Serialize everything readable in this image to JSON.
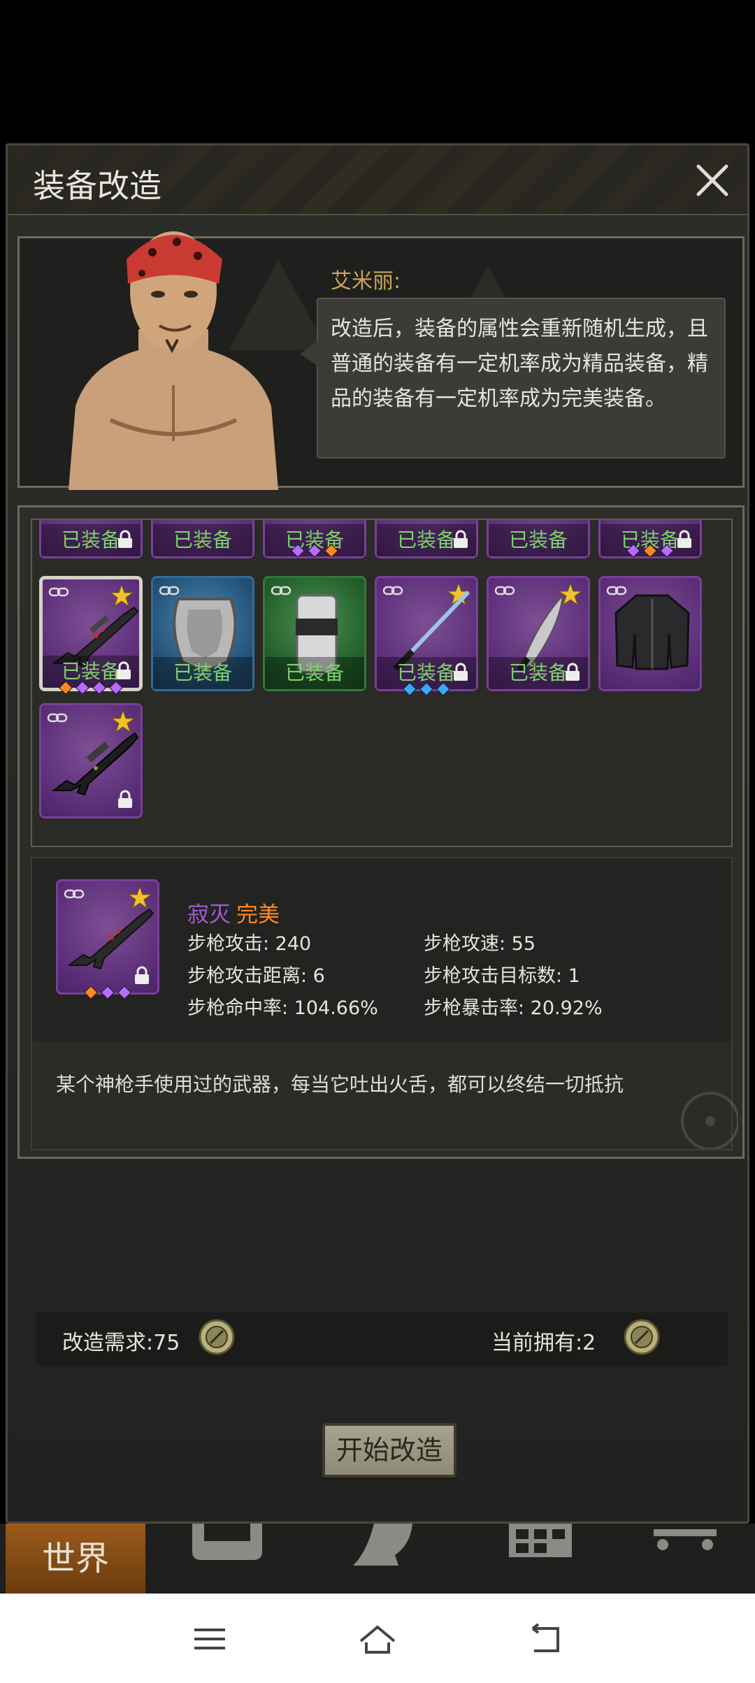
{
  "title": "装备改造",
  "npc": {
    "name": "艾米丽:",
    "speech": "改造后，装备的属性会重新随机生成，且普通的装备有一定机率成为精品装备，精品的装备有一定机率成为完美装备。"
  },
  "inventory": {
    "equipped_label": "已装备",
    "row1_count": 6,
    "items_row2": [
      {
        "icon": "assault-rifle-icon",
        "rarity": "purple",
        "equipped": true
      },
      {
        "icon": "shield-icon",
        "rarity": "blue",
        "equipped": true
      },
      {
        "icon": "arm-guard-icon",
        "rarity": "green",
        "equipped": true
      },
      {
        "icon": "katana-icon",
        "rarity": "purple",
        "equipped": true
      },
      {
        "icon": "machete-icon",
        "rarity": "purple",
        "equipped": true
      },
      {
        "icon": "jacket-icon",
        "rarity": "purple",
        "equipped": false
      }
    ],
    "items_row3": [
      {
        "icon": "sniper-rifle-icon",
        "rarity": "purple",
        "equipped": false
      }
    ]
  },
  "detail": {
    "name": "寂灭",
    "quality": "完美",
    "stats": {
      "attack": "步枪攻击: 240",
      "speed": "步枪攻速: 55",
      "range": "步枪攻击距离: 6",
      "targets": "步枪攻击目标数: 1",
      "accuracy": "步枪命中率: 104.66%",
      "crit": "步枪暴击率: 20.92%"
    },
    "description": "某个神枪手使用过的武器，每当它吐出火舌，都可以终结一切抵抗"
  },
  "requirement": {
    "need_label": "改造需求:75",
    "have_label": "当前拥有:2"
  },
  "start_button": "开始改造",
  "nav": {
    "world": "世界"
  },
  "colors": {
    "purple": "#5b2e78",
    "blue": "#234f74",
    "green": "#225c2a",
    "equipped_text": "#7ed26a",
    "quality_orange": "#ff8a1d"
  }
}
